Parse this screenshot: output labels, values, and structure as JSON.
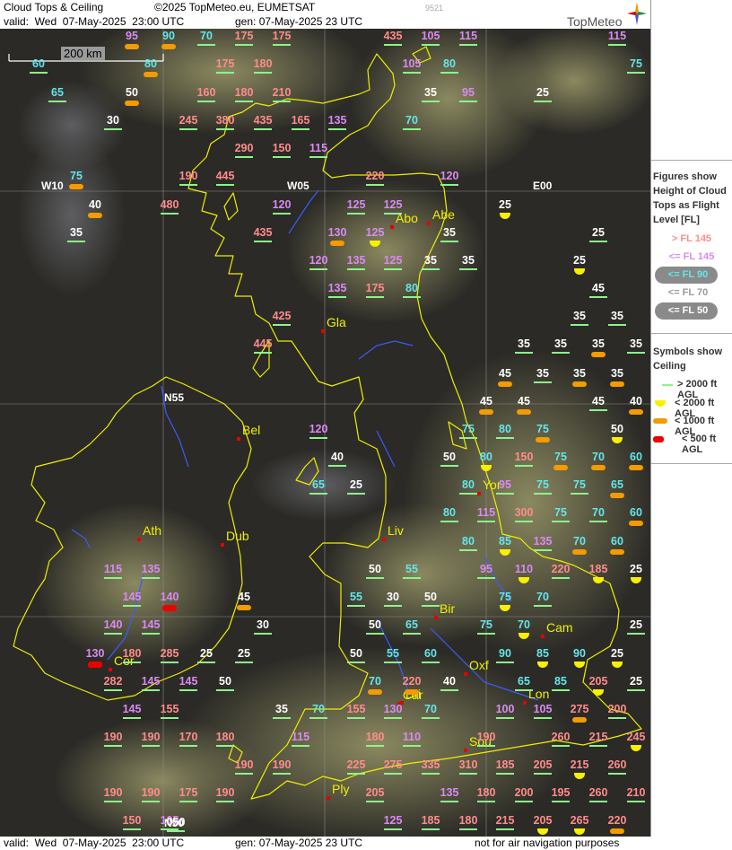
{
  "header": {
    "title": "Cloud Tops & Ceiling",
    "copyright": "©2025 TopMeteo.eu, EUMETSAT",
    "valid": "valid:  Wed  07-May-2025  23:00 UTC",
    "gen": "gen: 07-May-2025 23 UTC",
    "id": "9521",
    "logo": "TopMeteo"
  },
  "footer": {
    "valid": "valid:  Wed  07-May-2025  23:00 UTC",
    "gen": "gen: 07-May-2025 23 UTC",
    "disclaimer": "not for air navigation purposes"
  },
  "scale_bar": "200 km",
  "grid_labels": [
    "W10",
    "W05",
    "E00",
    "N55",
    "N50"
  ],
  "cities": [
    "Abo",
    "Abe",
    "Gla",
    "Bel",
    "Ath",
    "Dub",
    "Liv",
    "Yor",
    "Bir",
    "Cam",
    "Oxf",
    "Lon",
    "Car",
    "Bri",
    "Cor",
    "Sou",
    "Ply"
  ],
  "legend": {
    "figures_title": "Figures show Height of Cloud Tops as Flight Level  [FL]",
    "fl_items": [
      "> FL 145",
      "<= FL 145",
      "<= FL 90",
      "<= FL 70",
      "<= FL 50"
    ],
    "symbols_title": "Symbols show Ceiling",
    "ceiling_items": [
      "> 2000 ft AGL",
      "< 2000 ft AGL",
      "< 1000 ft AGL",
      "< 500 ft AGL"
    ]
  },
  "colors": {
    "fl_gt_145": "#ff8c8c",
    "fl_le_145": "#d98af3",
    "fl_le_90": "#63e6ea",
    "fl_le_50": "#ffffff",
    "ceil_gt_2000": "#8ef38c",
    "ceil_lt_2000": "#f7f000",
    "ceil_lt_1000": "#f39b00",
    "ceil_lt_500": "#ee0000",
    "coast": "#f0f000",
    "river": "#3a5cff"
  },
  "observations": [
    [
      "95",
      "lt1000"
    ],
    [
      "90",
      "lt1000"
    ],
    [
      "70",
      "gt2000"
    ],
    [
      "175",
      "gt2000"
    ],
    [
      "175",
      "gt2000"
    ],
    [
      "435",
      "gt2000"
    ],
    [
      "105",
      "gt2000"
    ],
    [
      "115",
      "gt2000"
    ],
    [
      "115",
      "gt2000"
    ],
    [
      "60",
      "gt2000"
    ],
    [
      "80",
      "lt1000"
    ],
    [
      "175",
      "gt2000"
    ],
    [
      "180",
      "gt2000"
    ],
    [
      "105",
      "gt2000"
    ],
    [
      "80",
      "gt2000"
    ],
    [
      "75",
      "gt2000"
    ],
    [
      "65",
      "gt2000"
    ],
    [
      "50",
      "lt1000"
    ],
    [
      "160",
      "gt2000"
    ],
    [
      "180",
      "gt2000"
    ],
    [
      "210",
      "gt2000"
    ],
    [
      "35",
      "gt2000"
    ],
    [
      "95",
      "gt2000"
    ],
    [
      "25",
      "gt2000"
    ],
    [
      "30",
      "gt2000"
    ],
    [
      "245",
      "gt2000"
    ],
    [
      "380",
      "gt2000"
    ],
    [
      "435",
      "gt2000"
    ],
    [
      "165",
      "gt2000"
    ],
    [
      "135",
      "gt2000"
    ],
    [
      "70",
      "gt2000"
    ],
    [
      "290",
      "gt2000"
    ],
    [
      "150",
      "gt2000"
    ],
    [
      "115",
      "gt2000"
    ],
    [
      "75",
      "lt1000"
    ],
    [
      "190",
      "gt2000"
    ],
    [
      "445",
      "gt2000"
    ],
    [
      "220",
      "gt2000"
    ],
    [
      "120",
      "gt2000"
    ],
    [
      "40",
      "lt1000"
    ],
    [
      "480",
      "gt2000"
    ],
    [
      "120",
      "gt2000"
    ],
    [
      "125",
      "gt2000"
    ],
    [
      "125",
      "gt2000"
    ],
    [
      "25",
      "lt2000"
    ],
    [
      "35",
      "gt2000"
    ],
    [
      "435",
      "gt2000"
    ],
    [
      "130",
      "lt1000"
    ],
    [
      "125",
      "lt2000"
    ],
    [
      "35",
      "gt2000"
    ],
    [
      "25",
      "gt2000"
    ],
    [
      "120",
      "gt2000"
    ],
    [
      "135",
      "gt2000"
    ],
    [
      "125",
      "gt2000"
    ],
    [
      "35",
      "gt2000"
    ],
    [
      "35",
      "gt2000"
    ],
    [
      "25",
      "lt2000"
    ],
    [
      "135",
      "gt2000"
    ],
    [
      "175",
      "gt2000"
    ],
    [
      "80",
      "gt2000"
    ],
    [
      "45",
      "gt2000"
    ],
    [
      "425",
      "gt2000"
    ],
    [
      "35",
      "gt2000"
    ],
    [
      "35",
      "gt2000"
    ],
    [
      "445",
      "gt2000"
    ],
    [
      "35",
      "gt2000"
    ],
    [
      "35",
      "gt2000"
    ],
    [
      "35",
      "lt1000"
    ],
    [
      "35",
      "gt2000"
    ],
    [
      "45",
      "lt1000"
    ],
    [
      "35",
      "gt2000"
    ],
    [
      "35",
      "lt1000"
    ],
    [
      "35",
      "lt1000"
    ],
    [
      "45",
      "lt1000"
    ],
    [
      "45",
      "lt1000"
    ],
    [
      "45",
      "gt2000"
    ],
    [
      "40",
      "lt1000"
    ],
    [
      "120",
      "gt2000"
    ],
    [
      "75",
      "gt2000"
    ],
    [
      "80",
      "gt2000"
    ],
    [
      "75",
      "lt1000"
    ],
    [
      "50",
      "lt2000"
    ],
    [
      "40",
      "gt2000"
    ],
    [
      "50",
      "gt2000"
    ],
    [
      "80",
      "lt2000"
    ],
    [
      "150",
      "gt2000"
    ],
    [
      "75",
      "lt1000"
    ],
    [
      "70",
      "lt1000"
    ],
    [
      "60",
      "lt1000"
    ],
    [
      "65",
      "gt2000"
    ],
    [
      "25",
      "gt2000"
    ],
    [
      "80",
      "gt2000"
    ],
    [
      "95",
      "gt2000"
    ],
    [
      "75",
      "gt2000"
    ],
    [
      "75",
      "gt2000"
    ],
    [
      "65",
      "lt1000"
    ],
    [
      "80",
      "gt2000"
    ],
    [
      "115",
      "gt2000"
    ],
    [
      "300",
      "gt2000"
    ],
    [
      "75",
      "gt2000"
    ],
    [
      "70",
      "gt2000"
    ],
    [
      "60",
      "lt1000"
    ],
    [
      "80",
      "gt2000"
    ],
    [
      "85",
      "lt2000"
    ],
    [
      "135",
      "gt2000"
    ],
    [
      "70",
      "lt1000"
    ],
    [
      "60",
      "lt1000"
    ],
    [
      "115",
      "gt2000"
    ],
    [
      "135",
      "gt2000"
    ],
    [
      "50",
      "gt2000"
    ],
    [
      "55",
      "gt2000"
    ],
    [
      "95",
      "gt2000"
    ],
    [
      "110",
      "lt2000"
    ],
    [
      "220",
      "gt2000"
    ],
    [
      "185",
      "lt2000"
    ],
    [
      "25",
      "lt2000"
    ],
    [
      "145",
      "gt2000"
    ],
    [
      "140",
      "lt500"
    ],
    [
      "45",
      "lt1000"
    ],
    [
      "55",
      "gt2000"
    ],
    [
      "30",
      "gt2000"
    ],
    [
      "50",
      "gt2000"
    ],
    [
      "75",
      "lt2000"
    ],
    [
      "70",
      "gt2000"
    ],
    [
      "140",
      "gt2000"
    ],
    [
      "145",
      "gt2000"
    ],
    [
      "30",
      "gt2000"
    ],
    [
      "50",
      "gt2000"
    ],
    [
      "65",
      "gt2000"
    ],
    [
      "75",
      "gt2000"
    ],
    [
      "70",
      "lt2000"
    ],
    [
      "25",
      "gt2000"
    ],
    [
      "130",
      "lt500"
    ],
    [
      "180",
      "gt2000"
    ],
    [
      "285",
      "gt2000"
    ],
    [
      "25",
      "gt2000"
    ],
    [
      "25",
      "gt2000"
    ],
    [
      "50",
      "gt2000"
    ],
    [
      "55",
      "gt2000"
    ],
    [
      "60",
      "gt2000"
    ],
    [
      "90",
      "gt2000"
    ],
    [
      "85",
      "lt2000"
    ],
    [
      "90",
      "lt2000"
    ],
    [
      "25",
      "lt2000"
    ],
    [
      "282",
      "gt2000"
    ],
    [
      "145",
      "gt2000"
    ],
    [
      "145",
      "gt2000"
    ],
    [
      "50",
      "gt2000"
    ],
    [
      "70",
      "lt1000"
    ],
    [
      "220",
      "lt1000"
    ],
    [
      "40",
      "gt2000"
    ],
    [
      "65",
      "gt2000"
    ],
    [
      "85",
      "gt2000"
    ],
    [
      "205",
      "lt2000"
    ],
    [
      "25",
      "gt2000"
    ],
    [
      "145",
      "gt2000"
    ],
    [
      "155",
      "gt2000"
    ],
    [
      "35",
      "gt2000"
    ],
    [
      "70",
      "gt2000"
    ],
    [
      "155",
      "gt2000"
    ],
    [
      "130",
      "gt2000"
    ],
    [
      "70",
      "gt2000"
    ],
    [
      "100",
      "gt2000"
    ],
    [
      "105",
      "gt2000"
    ],
    [
      "275",
      "lt1000"
    ],
    [
      "200",
      "gt2000"
    ],
    [
      "190",
      "gt2000"
    ],
    [
      "190",
      "gt2000"
    ],
    [
      "170",
      "gt2000"
    ],
    [
      "180",
      "gt2000"
    ],
    [
      "115",
      "gt2000"
    ],
    [
      "180",
      "gt2000"
    ],
    [
      "110",
      "gt2000"
    ],
    [
      "190",
      "gt2000"
    ],
    [
      "260",
      "gt2000"
    ],
    [
      "215",
      "gt2000"
    ],
    [
      "245",
      "lt2000"
    ],
    [
      "190",
      "gt2000"
    ],
    [
      "190",
      "gt2000"
    ],
    [
      "225",
      "gt2000"
    ],
    [
      "275",
      "gt2000"
    ],
    [
      "335",
      "gt2000"
    ],
    [
      "310",
      "gt2000"
    ],
    [
      "185",
      "gt2000"
    ],
    [
      "205",
      "gt2000"
    ],
    [
      "215",
      "lt2000"
    ],
    [
      "260",
      "gt2000"
    ],
    [
      "190",
      "gt2000"
    ],
    [
      "190",
      "gt2000"
    ],
    [
      "175",
      "gt2000"
    ],
    [
      "190",
      "gt2000"
    ],
    [
      "205",
      "gt2000"
    ],
    [
      "135",
      "gt2000"
    ],
    [
      "180",
      "gt2000"
    ],
    [
      "200",
      "gt2000"
    ],
    [
      "195",
      "gt2000"
    ],
    [
      "260",
      "gt2000"
    ],
    [
      "210",
      "gt2000"
    ],
    [
      "150",
      "gt2000"
    ],
    [
      "105",
      "gt2000"
    ],
    [
      "050",
      "gt2000"
    ],
    [
      "125",
      "gt2000"
    ],
    [
      "185",
      "gt2000"
    ],
    [
      "180",
      "gt2000"
    ],
    [
      "215",
      "gt2000"
    ],
    [
      "205",
      "lt2000"
    ],
    [
      "265",
      "lt2000"
    ],
    [
      "220",
      "lt1000"
    ]
  ]
}
